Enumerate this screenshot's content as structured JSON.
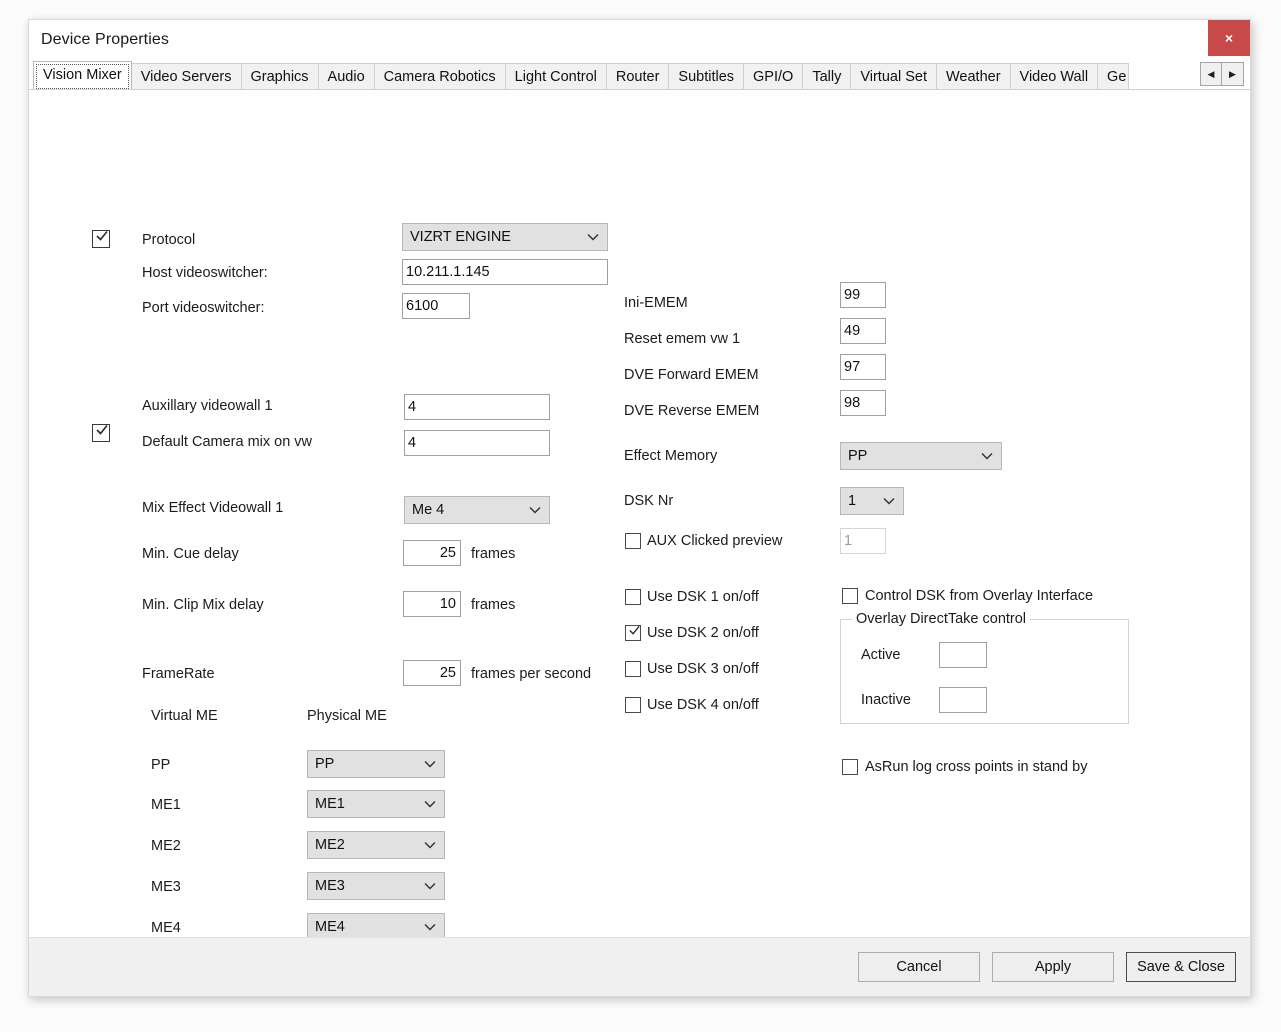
{
  "window": {
    "title": "Device Properties",
    "close_label": "×"
  },
  "tabs": {
    "items": [
      {
        "label": "Vision Mixer",
        "selected": true
      },
      {
        "label": "Video Servers",
        "selected": false
      },
      {
        "label": "Graphics",
        "selected": false
      },
      {
        "label": "Audio",
        "selected": false
      },
      {
        "label": "Camera Robotics",
        "selected": false
      },
      {
        "label": "Light Control",
        "selected": false
      },
      {
        "label": "Router",
        "selected": false
      },
      {
        "label": "Subtitles",
        "selected": false
      },
      {
        "label": "GPI/O",
        "selected": false
      },
      {
        "label": "Tally",
        "selected": false
      },
      {
        "label": "Virtual Set",
        "selected": false
      },
      {
        "label": "Weather",
        "selected": false
      },
      {
        "label": "Video Wall",
        "selected": false
      },
      {
        "label": "Ge",
        "selected": false
      }
    ],
    "scroll_left": "◀",
    "scroll_right": "▶"
  },
  "form": {
    "protocol": {
      "label": "Protocol",
      "checked": true,
      "value": "VIZRT ENGINE"
    },
    "host_videoswitcher": {
      "label": "Host videoswitcher:",
      "value": "10.211.1.145"
    },
    "port_videoswitcher": {
      "label": "Port videoswitcher:",
      "value": "6100"
    },
    "auxillary_videowall_1": {
      "label": "Auxillary videowall 1",
      "value": "4"
    },
    "default_camera_mix": {
      "label": "Default Camera mix on vw",
      "checked": true,
      "value": "4"
    },
    "mix_effect_videowall_1": {
      "label": "Mix Effect Videowall 1",
      "value": "Me 4"
    },
    "min_cue_delay": {
      "label": "Min. Cue delay",
      "value": "25",
      "unit": "frames"
    },
    "min_clip_mix_delay": {
      "label": "Min. Clip Mix delay",
      "value": "10",
      "unit": "frames"
    },
    "framerate": {
      "label": "FrameRate",
      "value": "25",
      "unit": "frames per second"
    },
    "me_table": {
      "header_virtual": "Virtual ME",
      "header_physical": "Physical ME",
      "rows": [
        {
          "virtual": "PP",
          "physical": "PP"
        },
        {
          "virtual": "ME1",
          "physical": "ME1"
        },
        {
          "virtual": "ME2",
          "physical": "ME2"
        },
        {
          "virtual": "ME3",
          "physical": "ME3"
        },
        {
          "virtual": "ME4",
          "physical": "ME4"
        }
      ]
    },
    "ini_emem": {
      "label": "Ini-EMEM",
      "value": "99"
    },
    "reset_emem_vw1": {
      "label": "Reset emem vw 1",
      "value": "49"
    },
    "dve_forward_emem": {
      "label": "DVE Forward EMEM",
      "value": "97"
    },
    "dve_reverse_emem": {
      "label": "DVE Reverse EMEM",
      "value": "98"
    },
    "effect_memory": {
      "label": "Effect Memory",
      "value": "PP"
    },
    "dsk_nr": {
      "label": "DSK Nr",
      "value": "1"
    },
    "aux_clicked_preview": {
      "label": "AUX Clicked preview",
      "checked": false,
      "value": "1",
      "disabled": true
    },
    "use_dsk": [
      {
        "label": "Use DSK 1 on/off",
        "checked": false
      },
      {
        "label": "Use DSK 2 on/off",
        "checked": true
      },
      {
        "label": "Use DSK 3 on/off",
        "checked": false
      },
      {
        "label": "Use DSK 4 on/off",
        "checked": false
      }
    ],
    "control_dsk_overlay": {
      "label": "Control DSK from Overlay Interface",
      "checked": false
    },
    "overlay_directtake": {
      "title": "Overlay DirectTake control",
      "active_label": "Active",
      "active_value": "",
      "inactive_label": "Inactive",
      "inactive_value": ""
    },
    "asrun_log": {
      "label": "AsRun log cross points in stand by",
      "checked": false
    }
  },
  "footer": {
    "cancel": "Cancel",
    "apply": "Apply",
    "save_close": "Save & Close"
  }
}
